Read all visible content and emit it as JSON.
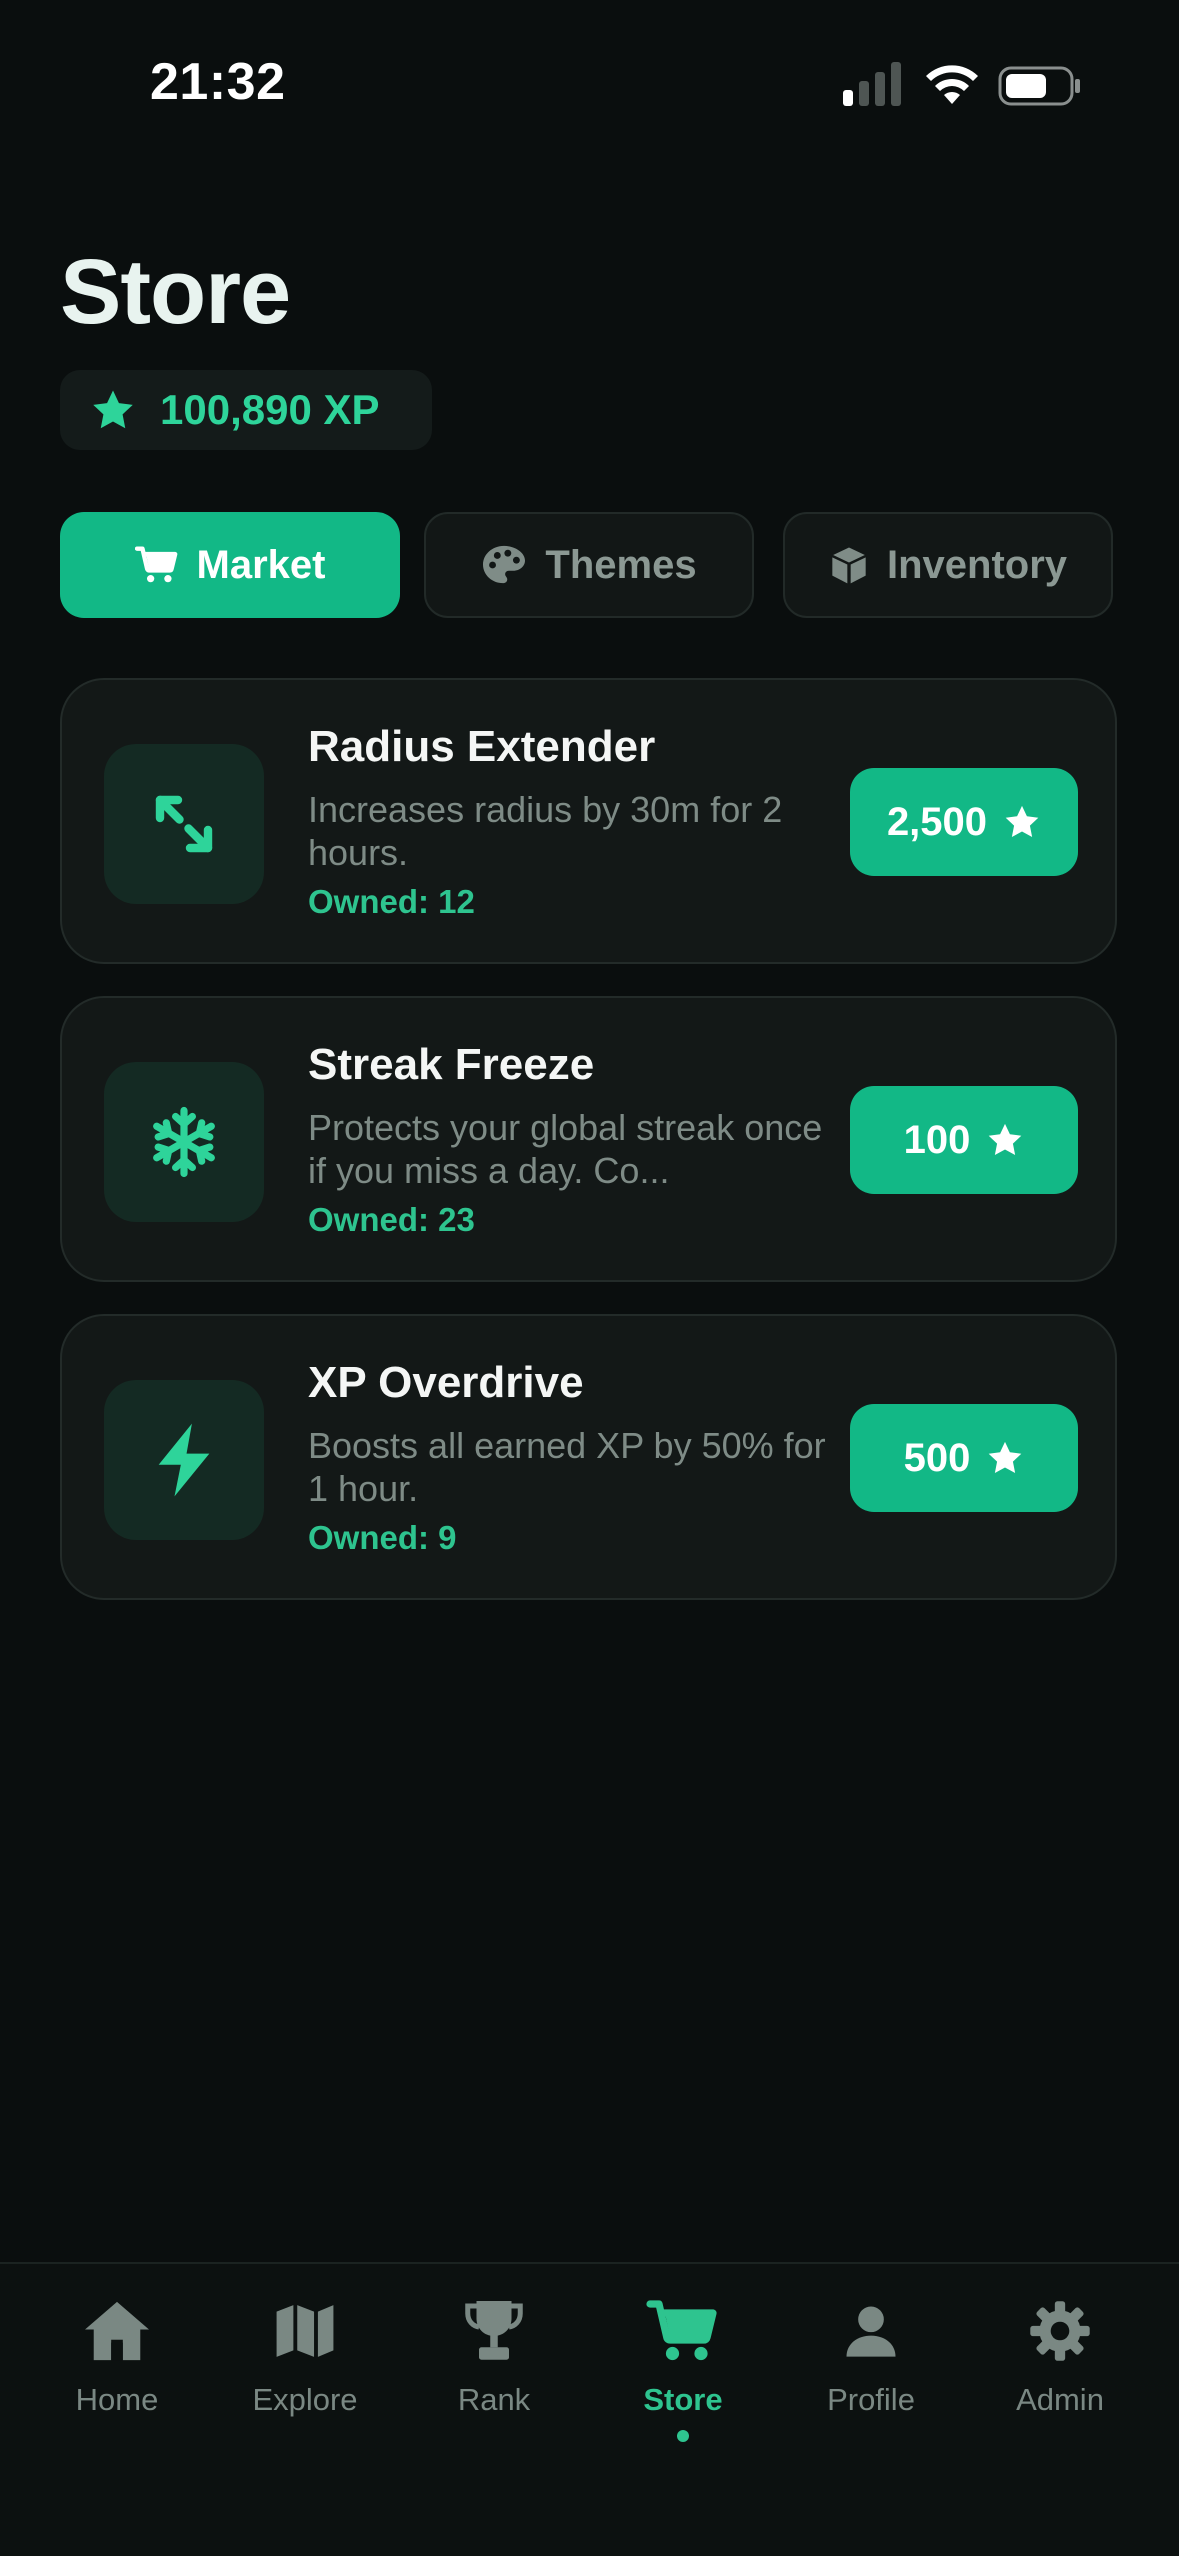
{
  "status_bar": {
    "time": "21:32"
  },
  "header": {
    "title": "Store",
    "xp_balance": "100,890 XP"
  },
  "tabs": [
    {
      "label": "Market",
      "icon": "cart-icon",
      "active": true
    },
    {
      "label": "Themes",
      "icon": "palette-icon",
      "active": false
    },
    {
      "label": "Inventory",
      "icon": "box-icon",
      "active": false
    }
  ],
  "items": [
    {
      "title": "Radius Extender",
      "description": "Increases radius by 30m for 2 hours.",
      "owned": "Owned: 12",
      "price": "2,500",
      "icon": "expand-arrows-icon"
    },
    {
      "title": "Streak Freeze",
      "description": "Protects your global streak once if you miss a day. Co...",
      "owned": "Owned: 23",
      "price": "100",
      "icon": "snowflake-icon"
    },
    {
      "title": "XP Overdrive",
      "description": "Boosts all earned XP by 50% for 1 hour.",
      "owned": "Owned: 9",
      "price": "500",
      "icon": "lightning-icon"
    }
  ],
  "nav": [
    {
      "label": "Home",
      "icon": "home-icon",
      "active": false
    },
    {
      "label": "Explore",
      "icon": "map-icon",
      "active": false
    },
    {
      "label": "Rank",
      "icon": "trophy-icon",
      "active": false
    },
    {
      "label": "Store",
      "icon": "cart-icon",
      "active": true
    },
    {
      "label": "Profile",
      "icon": "person-icon",
      "active": false
    },
    {
      "label": "Admin",
      "icon": "gear-icon",
      "active": false
    }
  ],
  "colors": {
    "background": "#0a0e0e",
    "accent": "#12b886",
    "accent_text": "#2ed49a",
    "card": "#131817",
    "muted_text": "#7e8b86"
  }
}
